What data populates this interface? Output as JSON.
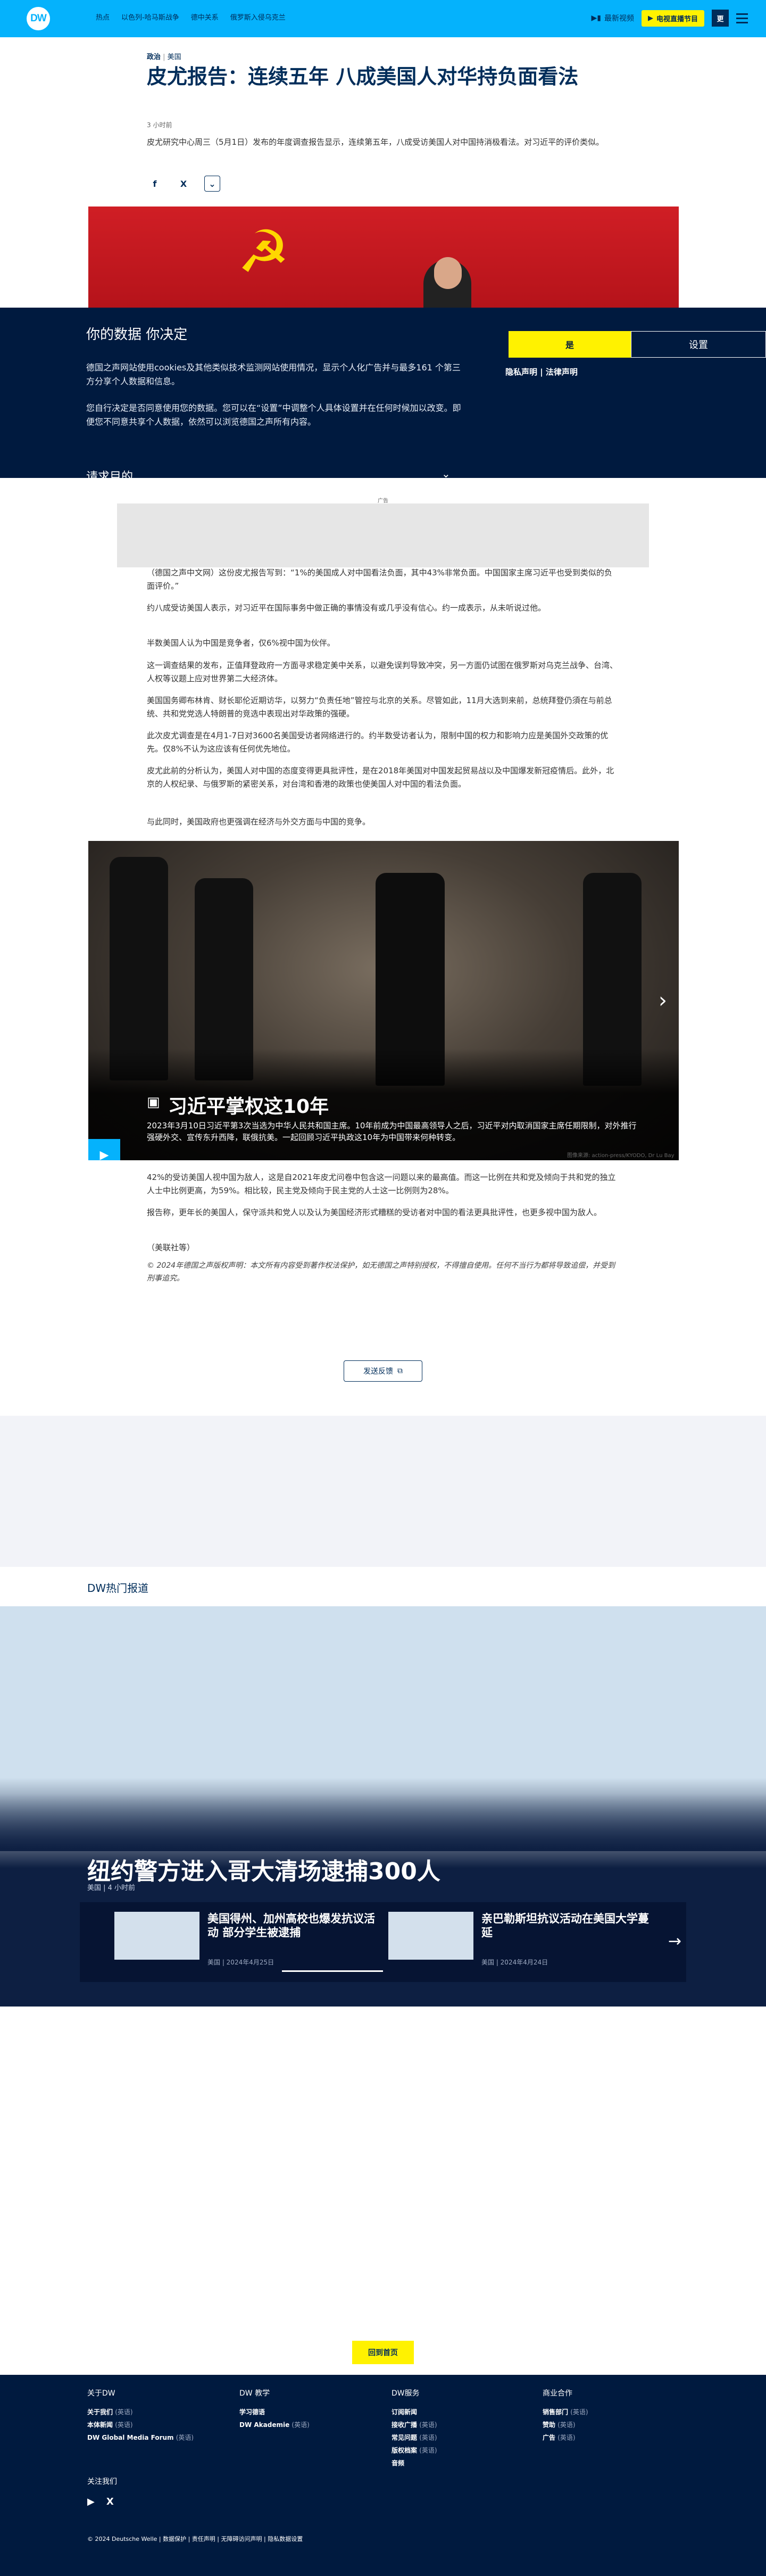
{
  "header": {
    "logo": "DW",
    "nav": [
      "热点",
      "以色列-哈马斯战争",
      "德中关系",
      "俄罗斯入侵乌克兰"
    ],
    "live_label": "最新视频",
    "program_label": "电视直播节目",
    "lang_label": "更"
  },
  "article": {
    "category": "政治",
    "region": "美国",
    "title": "皮尤报告：连续五年 八成美国人对华持负面看法",
    "time": "3 小时前",
    "lead": "皮尤研究中心周三（5月1日）发布的年度调查报告显示，连续第五年，八成受访美国人对中国持消极看法。对习近平的评价类似。",
    "share": {
      "facebook": "f",
      "x": "X",
      "expand": "⌄"
    },
    "ad_label": "广告",
    "p1": "（德国之声中文网）这份皮尤报告写到：“1%的美国成人对中国看法负面，其中43%非常负面。中国国家主席习近平也受到类似的负面评价。”",
    "p2": "约八成受访美国人表示，对习近平在国际事务中做正确的事情没有或几乎没有信心。约一成表示，从未听说过他。",
    "p3": "半数美国人认为中国是竞争者，仅6%视中国为伙伴。",
    "p4": "这一调查结果的发布，正值拜登政府一方面寻求稳定美中关系，以避免误判导致冲突，另一方面仍试图在俄罗斯对乌克兰战争、台湾、人权等议题上应对世界第二大经济体。",
    "p5": "美国国务卿布林肯、财长耶伦近期访华，以努力“负责任地”管控与北京的关系。尽管如此，11月大选到来前，总统拜登仍須在与前总统、共和党党选人特朗普的竞选中表现出对华政策的强硬。",
    "p6": "此次皮尤调查是在4月1-7日对3600名美国受访者网络进行的。约半数受访者认为，限制中国的权力和影响力应是美国外交政策的优先。仅8%不认为这应该有任何优先地位。",
    "p7": "皮尤此前的分析认为，美国人对中国的态度变得更具批评性，是在2018年美国对中国发起贸易战以及中国爆发新冠疫情后。此外，北京的人权纪录、与俄罗斯的紧密关系，对台湾和香港的政策也使美国人对中国的看法负面。",
    "p8": "与此同时，美国政府也更强调在经济与外交方面与中国的竞争。",
    "p9": "42%的受访美国人视中国为敌人，这是自2021年皮尤问卷中包含这一问题以来的最高值。而这一比例在共和党及倾向于共和党的独立人士中比例更高，为59%。相比较，民主党及倾向于民主党的人士这一比例则为28%。",
    "p10": "报告称，更年长的美国人，保守派共和党人以及认为美国经济形式糟糕的受访者对中国的看法更具批评性，也更多视中国为敌人。",
    "p11": "（美联社等）",
    "copyright": "© 2024年德国之声版权声明：本文所有内容受到著作权法保护，如无德国之声特别授权，不得擅自使用。任何不当行为都将导致追偿，并受到刑事追究。",
    "feedback": "发送反馈"
  },
  "cookie": {
    "title": "你的数据 你决定",
    "p1": "德国之声网站使用cookies及其他类似技术监测网站使用情况，显示个人化广告并与最多161 个第三方分享个人数据和信息。",
    "p2": "您自行决定是否同意使用您的数据。您可以在“设置”中调整个人具体设置并在任何时候加以改变。即便您不同意共享个人数据，依然可以浏览德国之声所有内容。",
    "accept": "是",
    "settings": "设置",
    "links": "隐私声明 | 法律声明",
    "purpose": "请求目的"
  },
  "video": {
    "title": "习近平掌权这10年",
    "desc": "2023年3月10日习近平第3次当选为中华人民共和国主席。10年前成为中国最高领导人之后，习近平对内取消国家主席任期限制，对外推行强硬外交、宣传东升西降，联俄抗美。一起回顾习近平执政这10年为中国带来何种转变。",
    "credit": "图像来源: action-press/KYODO, Dr Lu Bay"
  },
  "hot": {
    "section": "DW热门报道",
    "headline": "纽约警方进入哥大清场逮捕300人",
    "meta": "美国 | 4 小时前",
    "cards": [
      {
        "title": "美国得州、加州高校也爆发抗议活动 部分学生被逮捕",
        "meta": "美国 | 2024年4月25日"
      },
      {
        "title": "亲巴勒斯坦抗议活动在美国大学蔓延",
        "meta": "美国 | 2024年4月24日"
      }
    ]
  },
  "home_button": "回到首页",
  "footer": {
    "col1": {
      "title": "关于DW",
      "items": [
        [
          "关于我们",
          "(英语)"
        ],
        [
          "本体新闻",
          "(英语)"
        ],
        [
          "DW Global Media Forum",
          "(英语)"
        ]
      ]
    },
    "col2": {
      "title": "DW 教学",
      "items": [
        [
          "学习德语",
          ""
        ],
        [
          "DW Akademie",
          "(英语)"
        ]
      ]
    },
    "col3": {
      "title": "DW服务",
      "items": [
        [
          "订阅新闻",
          ""
        ],
        [
          "接收广播",
          "(英语)"
        ],
        [
          "常见问题",
          "(英语)"
        ],
        [
          "版权档案",
          "(英语)"
        ],
        [
          "音频",
          ""
        ]
      ]
    },
    "col4": {
      "title": "商业合作",
      "items": [
        [
          "销售部门",
          "(英语)"
        ],
        [
          "赞助",
          "(英语)"
        ],
        [
          "广告",
          "(英语)"
        ]
      ]
    },
    "follow": "关注我们",
    "legal": "© 2024 Deutsche Welle | 数据保护 | 责任声明 | 无障碍访问声明 | 隐私数据设置"
  }
}
